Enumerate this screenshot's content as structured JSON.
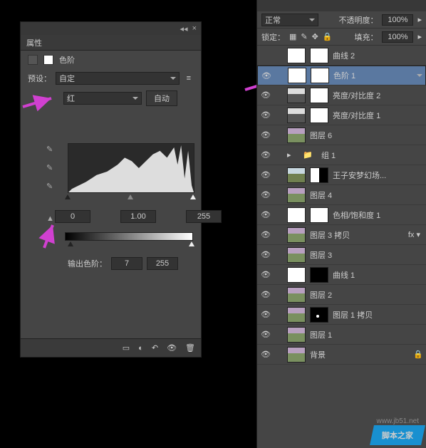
{
  "properties": {
    "tab": "属性",
    "adjustment_name": "色阶",
    "preset_label": "预设：",
    "preset_value": "自定",
    "channel": "红",
    "auto_btn": "自动",
    "input_black": "0",
    "input_gamma": "1.00",
    "input_white": "255",
    "output_label": "输出色阶：",
    "output_black": "7",
    "output_white": "255"
  },
  "layers_panel": {
    "blend_mode": "正常",
    "opacity_label": "不透明度：",
    "opacity": "100%",
    "lock_label": "锁定：",
    "fill_label": "填充：",
    "fill": "100%"
  },
  "layers": [
    {
      "name": "曲线 2",
      "t1": "white",
      "t2": "white",
      "eye": false
    },
    {
      "name": "色阶 1",
      "t1": "white",
      "t2": "white",
      "eye": true,
      "sel": true
    },
    {
      "name": "亮度/对比度 2",
      "t1": "bw",
      "t2": "white",
      "eye": true
    },
    {
      "name": "亮度/对比度 1",
      "t1": "bw",
      "t2": "white",
      "eye": true
    },
    {
      "name": "图层 6",
      "t1": "photo",
      "eye": true
    },
    {
      "name": "组 1",
      "group": true,
      "eye": true
    },
    {
      "name": "王子安梦幻场...",
      "t1": "photo2",
      "t2": "half",
      "eye": true
    },
    {
      "name": "图层 4",
      "t1": "photo",
      "eye": true
    },
    {
      "name": "色相/饱和度 1",
      "t1": "white",
      "t2": "white",
      "eye": true
    },
    {
      "name": "图层 3 拷贝",
      "t1": "photo",
      "fx": true,
      "eye": true
    },
    {
      "name": "图层 3",
      "t1": "photo",
      "eye": true
    },
    {
      "name": "曲线 1",
      "t1": "white",
      "t2": "black",
      "eye": true
    },
    {
      "name": "图层 2",
      "t1": "photo",
      "eye": true
    },
    {
      "name": "图层 1 拷贝",
      "t1": "photo",
      "t2": "dot",
      "eye": true
    },
    {
      "name": "图层 1",
      "t1": "photo",
      "eye": true
    },
    {
      "name": "背景",
      "t1": "photo",
      "eye": true,
      "lock": true
    }
  ],
  "watermark": "脚本之家",
  "watermark_url": "www.jb51.net"
}
